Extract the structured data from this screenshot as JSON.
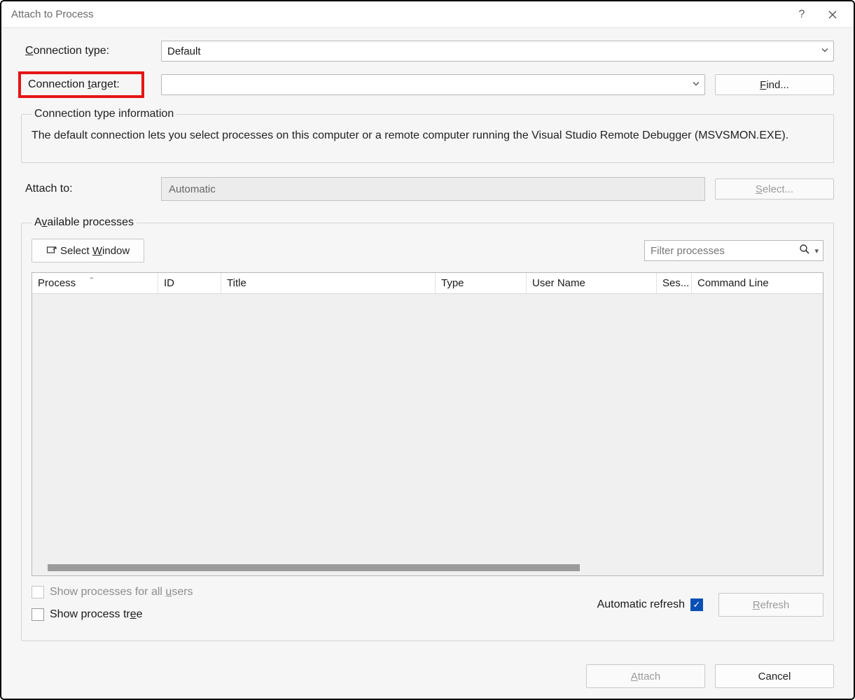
{
  "window": {
    "title": "Attach to Process"
  },
  "labels": {
    "connection_type": "Connection type:",
    "connection_target": "Connection target:",
    "attach_to": "Attach to:",
    "info_legend": "Connection type information",
    "available_legend": "Available processes"
  },
  "fields": {
    "connection_type_value": "Default",
    "connection_target_value": "",
    "attach_to_value": "Automatic"
  },
  "buttons": {
    "find": "Find...",
    "select": "Select...",
    "select_window": "Select Window",
    "refresh": "Refresh",
    "attach": "Attach",
    "cancel": "Cancel"
  },
  "info_text": "The default connection lets you select processes on this computer or a remote computer running the Visual Studio Remote Debugger (MSVSMON.EXE).",
  "filter_placeholder": "Filter processes",
  "columns": {
    "process": "Process",
    "id": "ID",
    "title": "Title",
    "type": "Type",
    "user_name": "User Name",
    "session": "Ses...",
    "command_line": "Command Line"
  },
  "checkboxes": {
    "show_all_users": "Show processes for all users",
    "show_process_tree": "Show process tree",
    "auto_refresh": "Automatic refresh"
  },
  "state": {
    "show_all_users": false,
    "show_process_tree": false,
    "auto_refresh": true
  }
}
